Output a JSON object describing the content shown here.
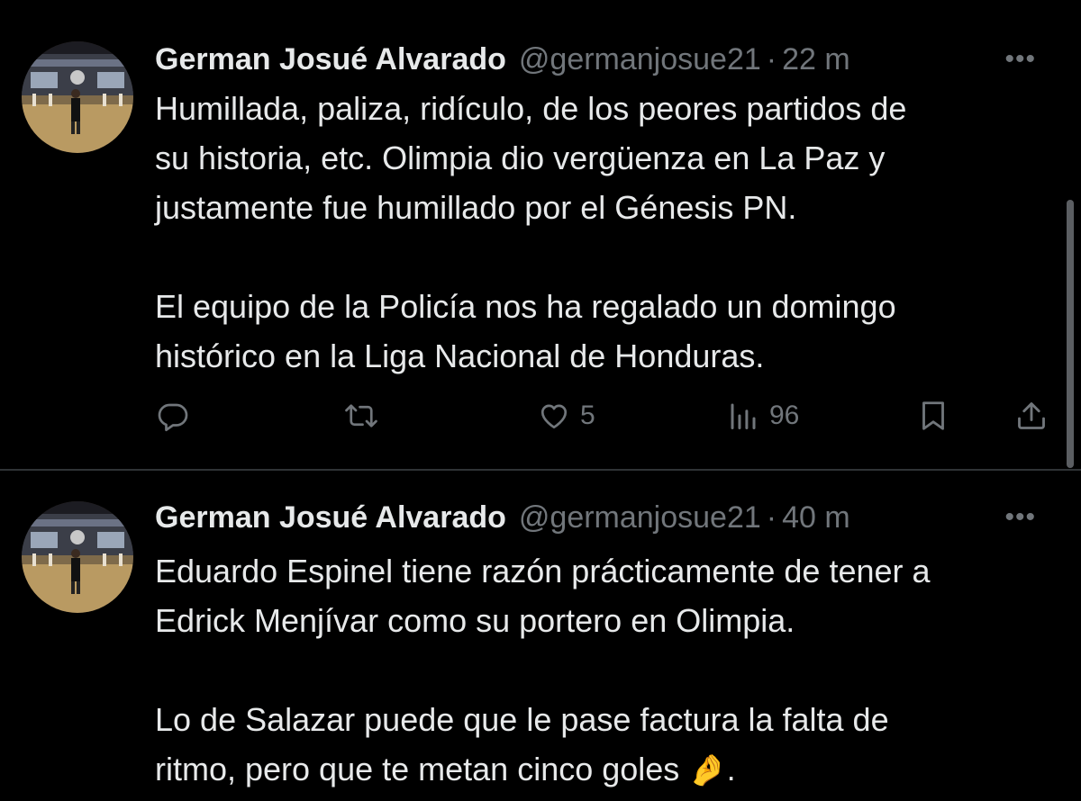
{
  "colors": {
    "background": "#000000",
    "primary_text": "#e7e9ea",
    "secondary_text": "#71767b",
    "divider": "#2f3336"
  },
  "tweets": [
    {
      "author_name": "German Josué Alvarado",
      "handle": "@germanjosue21",
      "separator": "·",
      "time": "22 m",
      "more_icon": "more-horizontal-icon",
      "more_label": "•••",
      "paragraphs": [
        [
          "Humillada, paliza, ridículo, de los peores partidos de",
          "su historia, etc. Olimpia dio vergüenza en La Paz y",
          "justamente fue humillado por el Génesis PN."
        ],
        [
          "El equipo de la Policía nos ha regalado un domingo",
          "histórico en la Liga Nacional de Honduras."
        ]
      ],
      "actions": {
        "reply_icon": "reply-icon",
        "retweet_icon": "retweet-icon",
        "like_icon": "heart-icon",
        "like_count": "5",
        "views_icon": "views-icon",
        "views_count": "96",
        "bookmark_icon": "bookmark-icon",
        "share_icon": "share-icon"
      }
    },
    {
      "author_name": "German Josué Alvarado",
      "handle": "@germanjosue21",
      "separator": "·",
      "time": "40 m",
      "more_icon": "more-horizontal-icon",
      "more_label": "•••",
      "paragraphs": [
        [
          "Eduardo Espinel tiene razón prácticamente de tener a",
          "Edrick Menjívar como su portero en Olimpia."
        ],
        [
          "Lo de Salazar puede que le pase factura la falta de"
        ]
      ],
      "last_line_text": "ritmo, pero que te metan cinco goles",
      "last_line_emoji": "🤌",
      "last_line_end": "."
    }
  ]
}
